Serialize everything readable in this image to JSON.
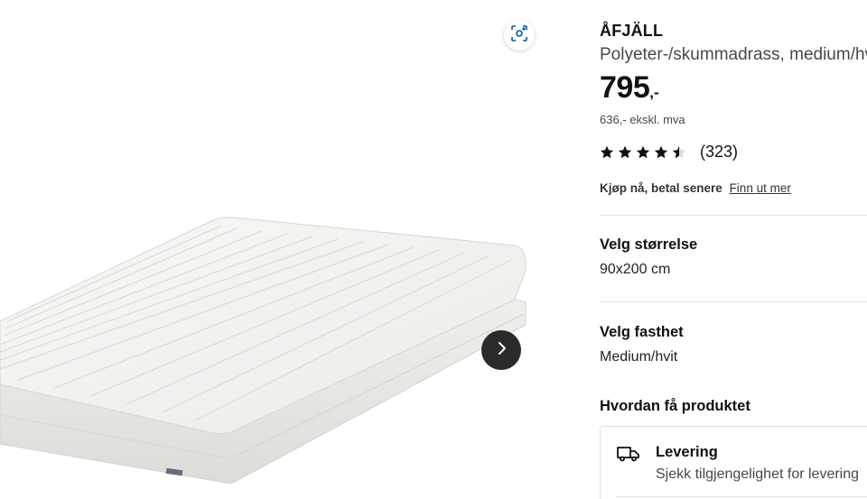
{
  "product": {
    "name": "ÅFJÄLL",
    "description": "Polyeter-/skummadrass, medium/hvit",
    "price_integer": "795",
    "price_decimal": ",-",
    "price_ex_vat": "636,- ekskl. mva",
    "rating_value": 4.5,
    "rating_max": 5,
    "review_count": "(323)"
  },
  "pay_later": {
    "label": "Kjøp nå, betal senere",
    "link": "Finn ut mer"
  },
  "size": {
    "title": "Velg størrelse",
    "value": "90x200 cm"
  },
  "firmness": {
    "title": "Velg fasthet",
    "value": "Medium/hvit"
  },
  "fulfillment": {
    "title": "Hvordan få produktet",
    "delivery_title": "Levering",
    "delivery_sub": "Sjekk tilgjengelighet for levering"
  },
  "icons": {
    "scan": "visual-search-icon",
    "next": "chevron-right-icon",
    "star": "star-icon",
    "truck": "truck-icon"
  },
  "colors": {
    "text": "#111111",
    "muted": "#484848",
    "divider": "#dfdfdf",
    "next_button_bg": "#2b2b2b",
    "mattress": "#f2f2f0"
  }
}
